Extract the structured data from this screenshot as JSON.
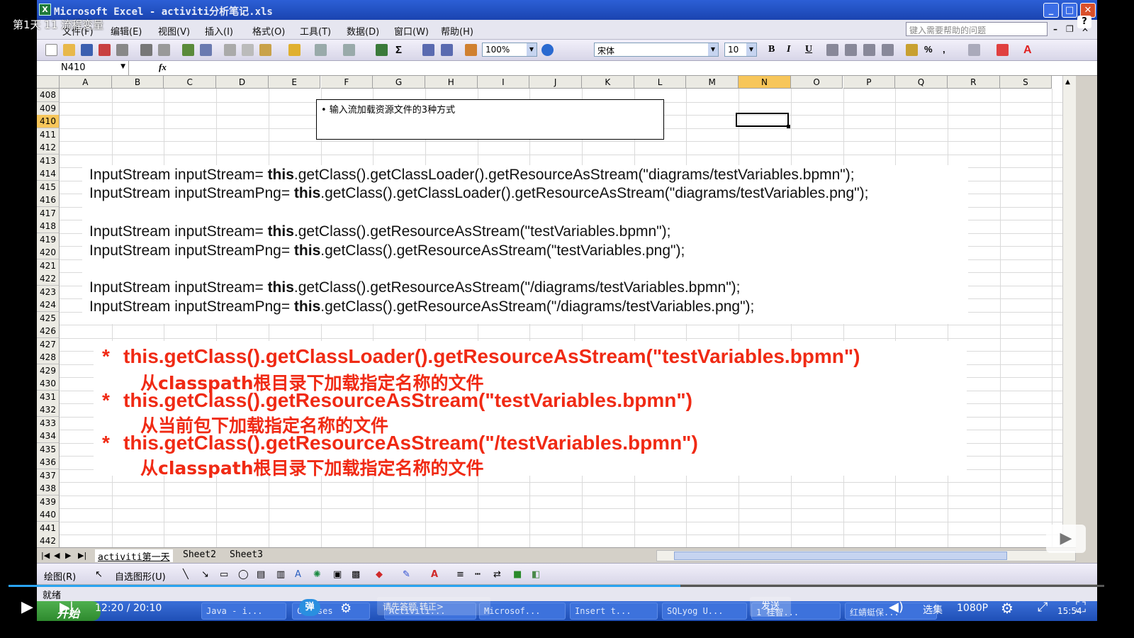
{
  "video": {
    "title": "第1天 11 流程变量",
    "current_time": "12:20 / 20:10",
    "quality": "1080P",
    "select_label": "选集",
    "bullet_label": "弹",
    "danmu_placeholder": "请先答题 转正>",
    "send_label": "发送",
    "progress_percent": 61.3,
    "help_label": "?"
  },
  "excel": {
    "window_title": "Microsoft Excel - activiti分析笔记.xls",
    "menu": [
      "文件(F)",
      "编辑(E)",
      "视图(V)",
      "插入(I)",
      "格式(O)",
      "工具(T)",
      "数据(D)",
      "窗口(W)",
      "帮助(H)"
    ],
    "help_placeholder": "键入需要帮助的问题",
    "zoom": "100%",
    "font_name": "宋体",
    "font_size": "10",
    "bold": "B",
    "italic": "I",
    "underline": "U",
    "name_box": "N410",
    "fx_label": "fx",
    "columns": [
      "A",
      "B",
      "C",
      "D",
      "E",
      "F",
      "G",
      "H",
      "I",
      "J",
      "K",
      "L",
      "M",
      "N",
      "O",
      "P",
      "Q",
      "R",
      "S"
    ],
    "selected_column": "N",
    "rows": [
      "408",
      "409",
      "410",
      "411",
      "412",
      "413",
      "414",
      "415",
      "416",
      "417",
      "418",
      "419",
      "420",
      "421",
      "422",
      "423",
      "424",
      "425",
      "426",
      "427",
      "428",
      "429",
      "430",
      "431",
      "432",
      "433",
      "434",
      "435",
      "436",
      "437",
      "438",
      "439",
      "440",
      "441",
      "442"
    ],
    "selected_row": "410",
    "textbox_text": "• 输入流加载资源文件的3种方式",
    "code_lines": [
      {
        "a": "InputStream inputStream= ",
        "kw": "this",
        "b": ".getClass().getClassLoader().getResourceAsStream(\"diagrams/testVariables.bpmn\");"
      },
      {
        "a": "InputStream inputStreamPng= ",
        "kw": "this",
        "b": ".getClass().getClassLoader().getResourceAsStream(\"diagrams/testVariables.png\");"
      },
      {
        "a": "InputStream inputStream= ",
        "kw": "this",
        "b": ".getClass().getResourceAsStream(\"testVariables.bpmn\");"
      },
      {
        "a": "InputStream inputStreamPng= ",
        "kw": "this",
        "b": ".getClass().getResourceAsStream(\"testVariables.png\");"
      },
      {
        "a": "InputStream inputStream= ",
        "kw": "this",
        "b": ".getClass().getResourceAsStream(\"/diagrams/testVariables.bpmn\");"
      },
      {
        "a": "InputStream inputStreamPng= ",
        "kw": "this",
        "b": ".getClass().getResourceAsStream(\"/diagrams/testVariables.png\");"
      }
    ],
    "notes": [
      {
        "star": "*",
        "code": "this.getClass().getClassLoader().getResourceAsStream(\"testVariables.bpmn\")",
        "desc": "从classpath根目录下加载指定名称的文件"
      },
      {
        "star": "*",
        "code": "this.getClass().getResourceAsStream(\"testVariables.bpmn\")",
        "desc": "从当前包下加载指定名称的文件"
      },
      {
        "star": "*",
        "code": "this.getClass().getResourceAsStream(\"/testVariables.bpmn\")",
        "desc": "从classpath根目录下加载指定名称的文件"
      }
    ],
    "sheet_tabs": [
      "activiti第一天",
      "Sheet2",
      "Sheet3"
    ],
    "draw_label": "绘图(R)",
    "autoshape_label": "自选图形(U)",
    "status": "就绪",
    "start_label": "开始",
    "taskbar_items": [
      "Java - i...",
      "Classes",
      "Activiti...",
      "Microsof...",
      "Insert t...",
      "SQLyog U...",
      "1 桂智...",
      "红蜻蜓保..."
    ],
    "clock": "15:54",
    "colors": {
      "code_red": "#f02a14",
      "selection": "#f7c65a",
      "title_blue": "#1a44b0"
    }
  }
}
